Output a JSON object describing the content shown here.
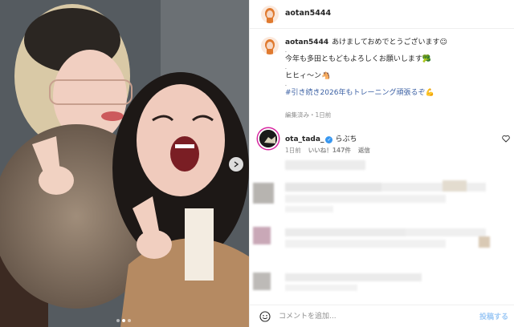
{
  "header": {
    "username": "aotan5444"
  },
  "caption": {
    "username": "aotan5444",
    "line1": "あけましておめでとうございます☺︎",
    "dot1": ".",
    "line2": "今年も多田ともどもよろしくお願いします🥦",
    "dot2": ".",
    "line3": "ヒヒィ〜ン🐴",
    "dot3": ".",
    "hashtag": "#引き続き2026年もトレーニング頑張るぞ💪",
    "meta": "編集済み・1日前"
  },
  "comment": {
    "username": "ota_tada_",
    "verified_icon": "✓",
    "text": "らぶち",
    "time": "1日前",
    "likes": "いいね！147件",
    "reply": "返信"
  },
  "footer": {
    "placeholder": "コメントを追加...",
    "post_label": "投稿する"
  },
  "colors": {
    "link": "#3a5fa3",
    "verified": "#3897f0",
    "post_button": "#9cc8f5",
    "meta": "#8e8e8e"
  },
  "carousel": {
    "slide_count": 3,
    "active_slide": 2
  }
}
